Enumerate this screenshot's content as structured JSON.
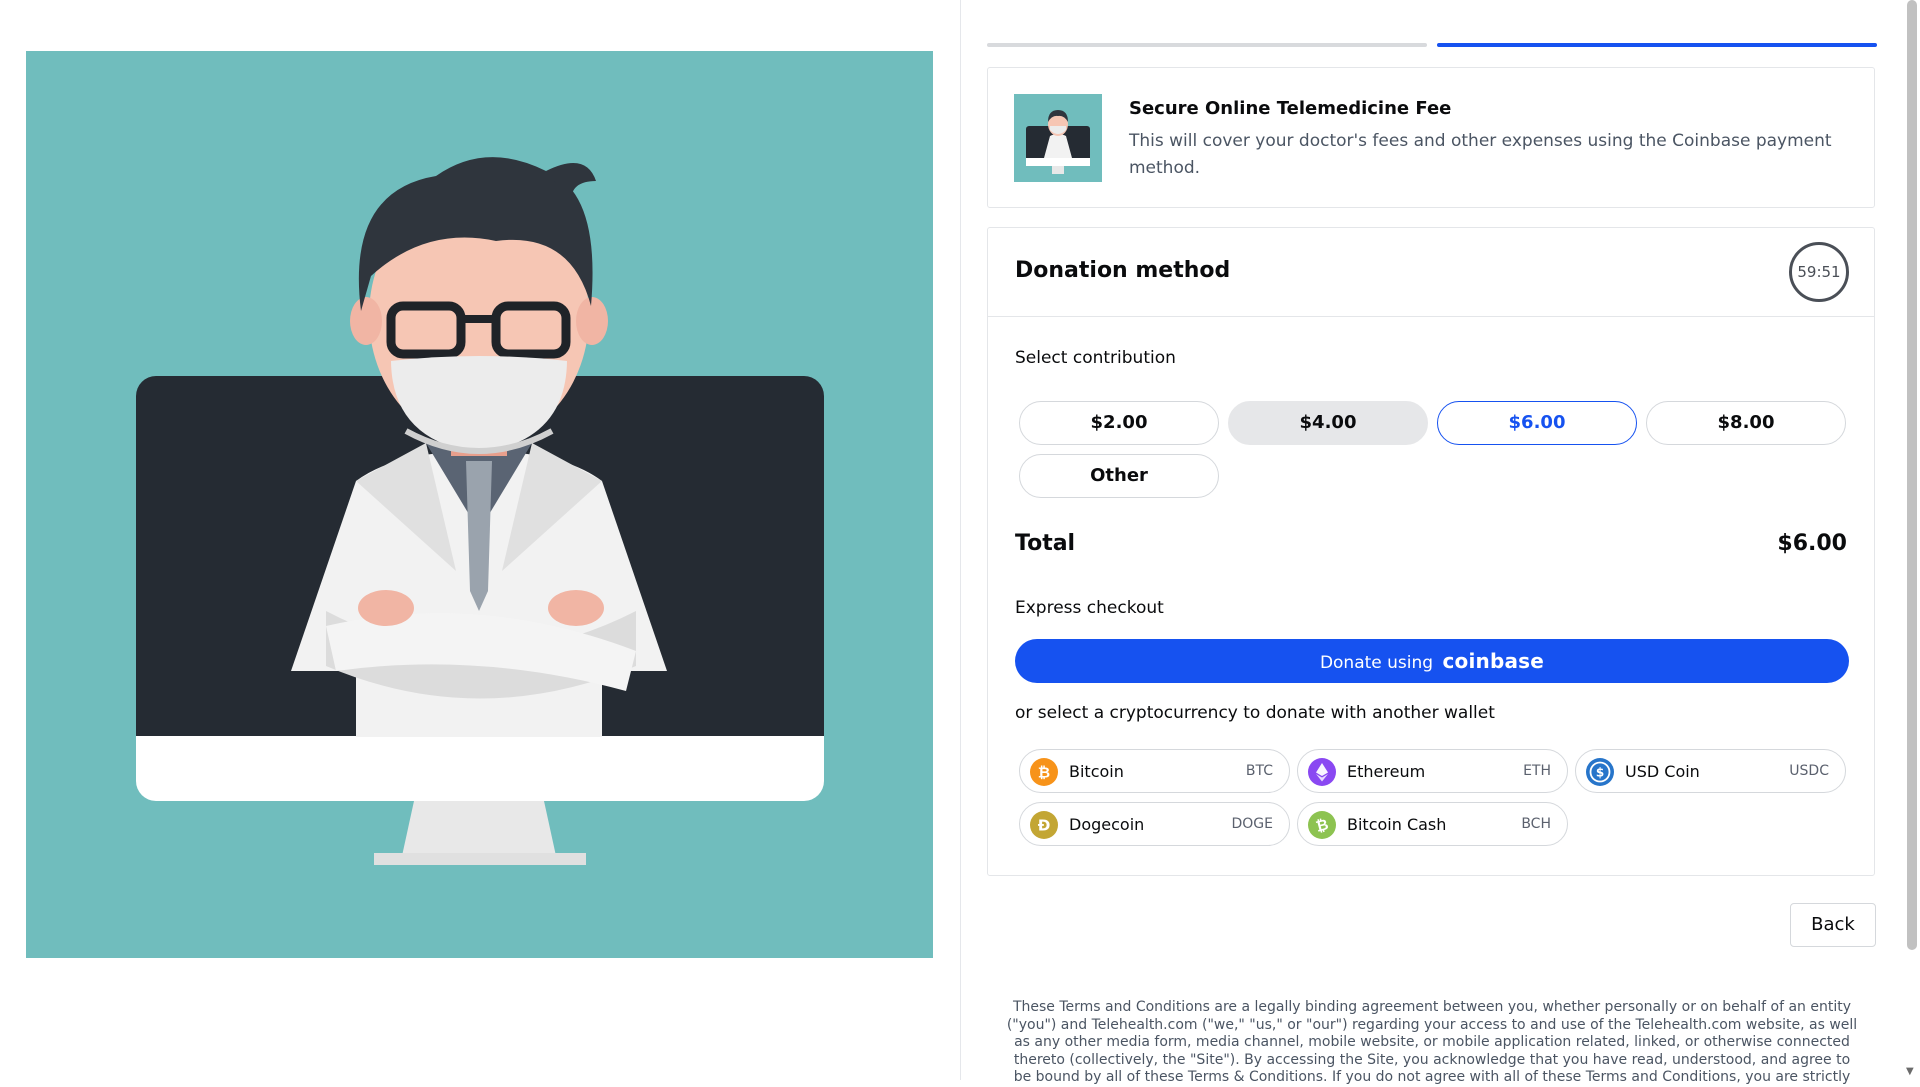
{
  "product": {
    "title": "Secure Online Telemedicine Fee",
    "description": "This will cover your doctor's fees and other expenses using the Coinbase payment method."
  },
  "donation": {
    "title": "Donation method",
    "timer": "59:51",
    "select_label": "Select contribution",
    "amounts": [
      "$2.00",
      "$4.00",
      "$6.00",
      "$8.00",
      "Other"
    ],
    "selected_amount": "$6.00",
    "total_label": "Total",
    "total_value": "$6.00",
    "express_label": "Express checkout",
    "coinbase_button_prefix": "Donate using",
    "coinbase_brand": "coinbase",
    "alt_label": "or select a cryptocurrency to donate with another wallet",
    "coins": [
      {
        "name": "Bitcoin",
        "ticker": "BTC",
        "color": "#f7931a",
        "icon": "bitcoin-icon"
      },
      {
        "name": "Ethereum",
        "ticker": "ETH",
        "color": "#8a48f2",
        "icon": "ethereum-icon"
      },
      {
        "name": "USD Coin",
        "ticker": "USDC",
        "color": "#2775ca",
        "icon": "usdc-icon"
      },
      {
        "name": "Dogecoin",
        "ticker": "DOGE",
        "color": "#c3a634",
        "icon": "dogecoin-icon"
      },
      {
        "name": "Bitcoin Cash",
        "ticker": "BCH",
        "color": "#8dc351",
        "icon": "bitcoin-cash-icon"
      }
    ]
  },
  "back_label": "Back",
  "terms": "These Terms and Conditions are a legally binding agreement between you, whether personally or on behalf of an entity (\"you\") and Telehealth.com (\"we,\" \"us,\" or \"our\") regarding your access to and use of the Telehealth.com website, as well as any other media form, media channel, mobile website, or mobile application related, linked, or otherwise connected thereto (collectively, the \"Site\"). By accessing the Site, you acknowledge that you have read, understood, and agree to be bound by all of these Terms & Conditions. If you do not agree with all of these Terms and Conditions, you are strictly",
  "colors": {
    "accent": "#1652f0",
    "illustration_bg": "#70bdbd"
  }
}
